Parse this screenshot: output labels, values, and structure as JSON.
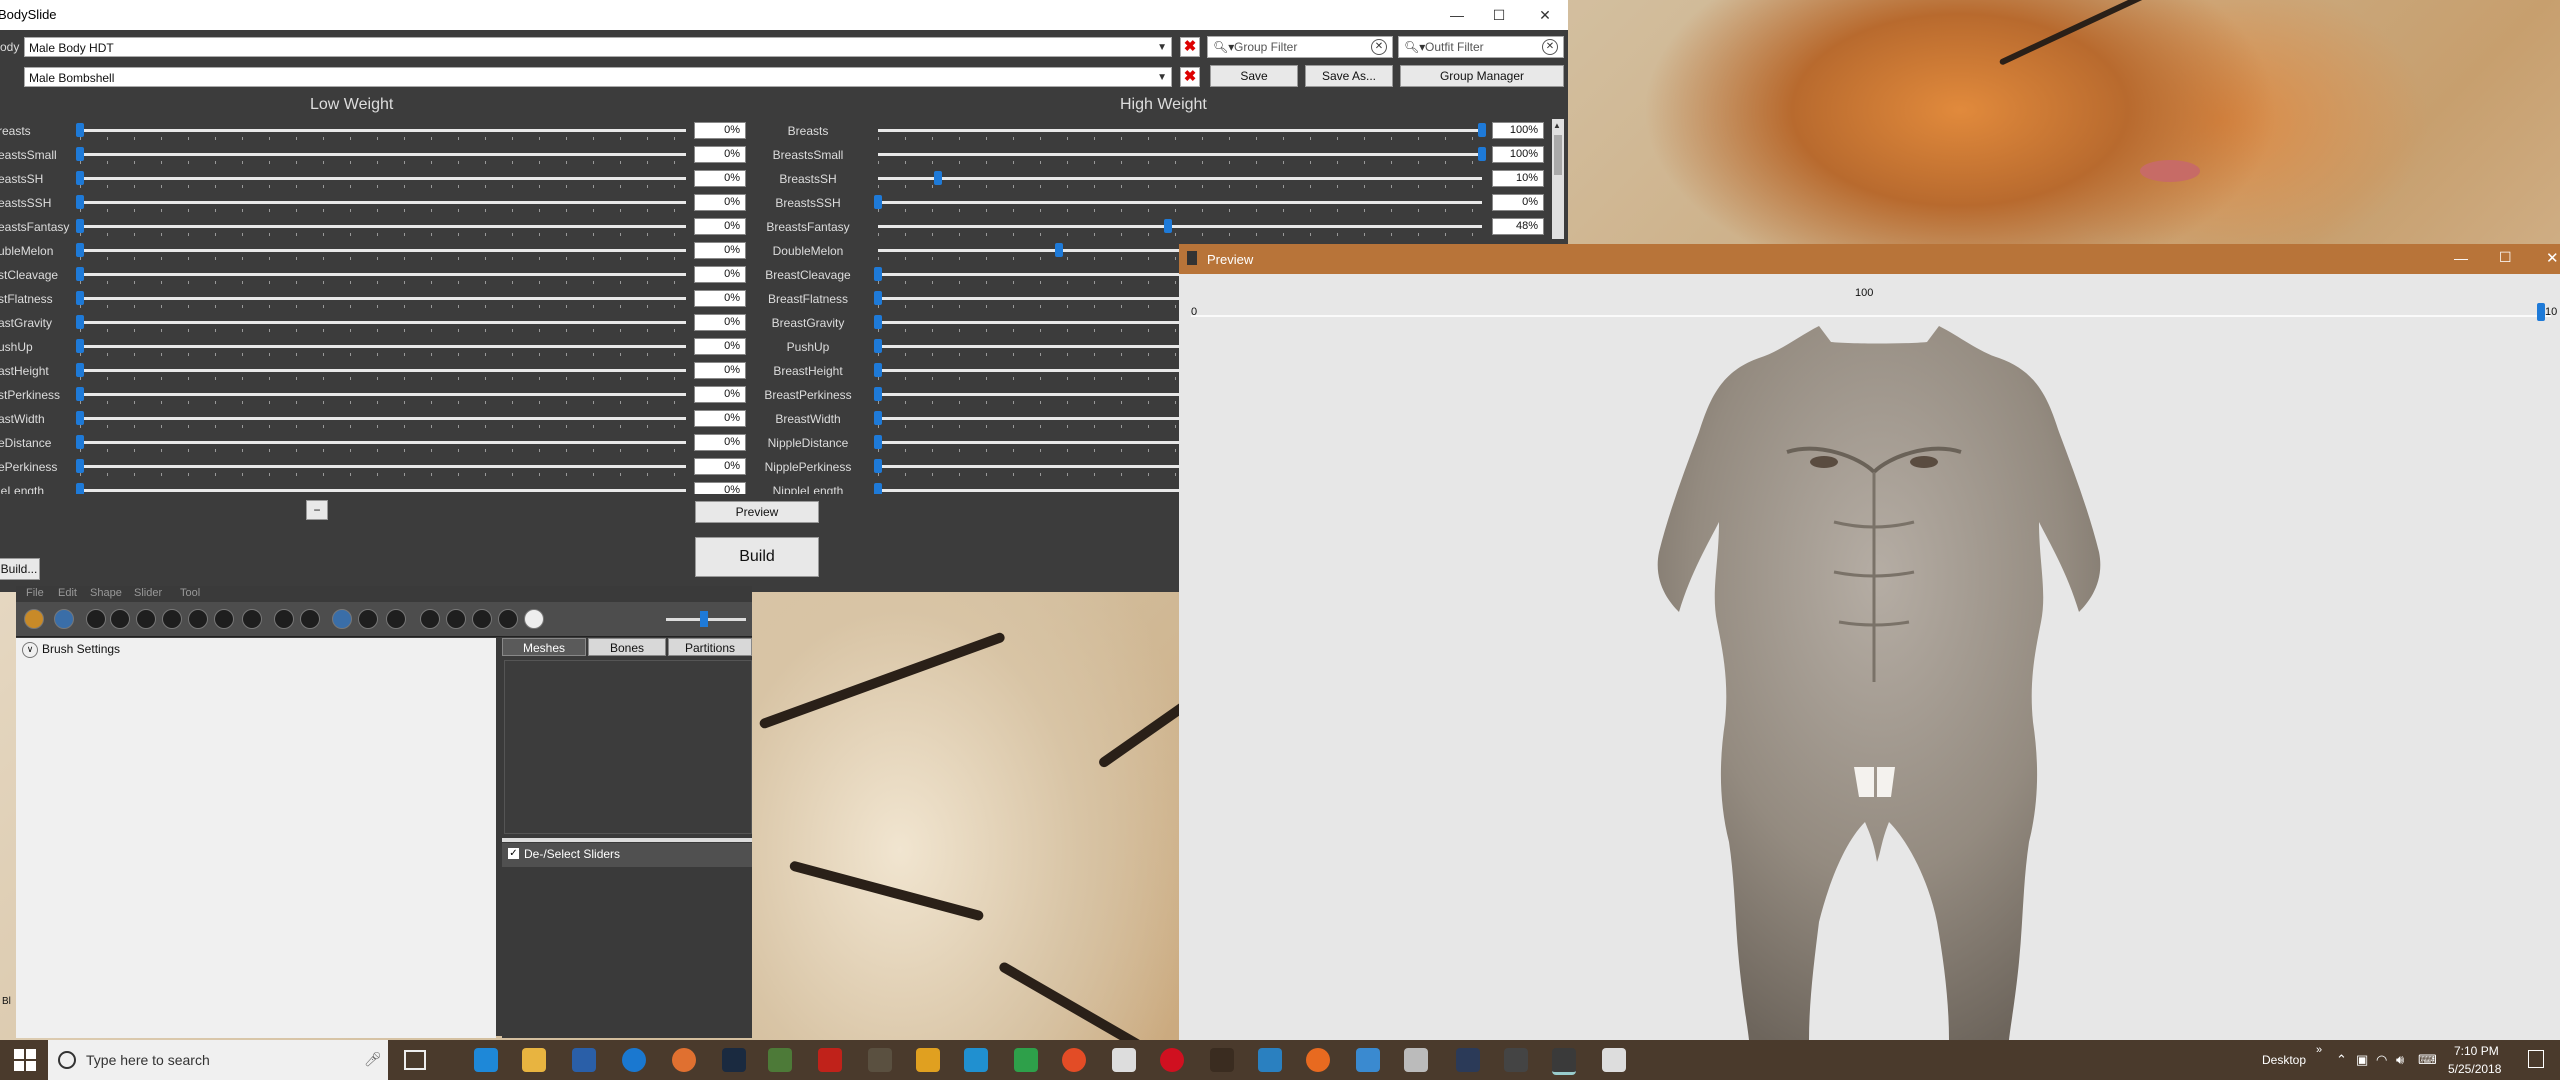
{
  "bodyslide": {
    "title": "BodySlide",
    "body_label": "Body",
    "outfit_value": "Male Body HDT",
    "preset_value": "Male Bombshell",
    "group_filter_placeholder": "Group Filter",
    "outfit_filter_placeholder": "Outfit Filter",
    "save_label": "Save",
    "save_as_label": "Save As...",
    "group_manager_label": "Group Manager",
    "low_weight_header": "Low Weight",
    "high_weight_header": "High Weight",
    "sliders": [
      {
        "left_label": "reasts",
        "name": "Breasts",
        "low": "0%",
        "high": "100%",
        "low_frac": 0.0,
        "high_frac": 1.0
      },
      {
        "left_label": "eastsSmall",
        "name": "BreastsSmall",
        "low": "0%",
        "high": "100%",
        "low_frac": 0.0,
        "high_frac": 1.0
      },
      {
        "left_label": "eastsSH",
        "name": "BreastsSH",
        "low": "0%",
        "high": "10%",
        "low_frac": 0.0,
        "high_frac": 0.1
      },
      {
        "left_label": "eastsSSH",
        "name": "BreastsSSH",
        "low": "0%",
        "high": "0%",
        "low_frac": 0.0,
        "high_frac": 0.0
      },
      {
        "left_label": "eastsFantasy",
        "name": "BreastsFantasy",
        "low": "0%",
        "high": "48%",
        "low_frac": 0.0,
        "high_frac": 0.48
      },
      {
        "left_label": "ubleMelon",
        "name": "DoubleMelon",
        "low": "0%",
        "high": "",
        "low_frac": 0.0,
        "high_frac": 0.3
      },
      {
        "left_label": "stCleavage",
        "name": "BreastCleavage",
        "low": "0%",
        "high": "",
        "low_frac": 0.0,
        "high_frac": 0.0
      },
      {
        "left_label": "stFlatness",
        "name": "BreastFlatness",
        "low": "0%",
        "high": "",
        "low_frac": 0.0,
        "high_frac": 0.0
      },
      {
        "left_label": "astGravity",
        "name": "BreastGravity",
        "low": "0%",
        "high": "",
        "low_frac": 0.0,
        "high_frac": 0.0
      },
      {
        "left_label": "ushUp",
        "name": "PushUp",
        "low": "0%",
        "high": "",
        "low_frac": 0.0,
        "high_frac": 0.0
      },
      {
        "left_label": "astHeight",
        "name": "BreastHeight",
        "low": "0%",
        "high": "",
        "low_frac": 0.0,
        "high_frac": 0.0
      },
      {
        "left_label": "stPerkiness",
        "name": "BreastPerkiness",
        "low": "0%",
        "high": "",
        "low_frac": 0.0,
        "high_frac": 0.0
      },
      {
        "left_label": "astWidth",
        "name": "BreastWidth",
        "low": "0%",
        "high": "",
        "low_frac": 0.0,
        "high_frac": 0.0
      },
      {
        "left_label": "eDistance",
        "name": "NippleDistance",
        "low": "0%",
        "high": "",
        "low_frac": 0.0,
        "high_frac": 0.0
      },
      {
        "left_label": "ePerkiness",
        "name": "NipplePerkiness",
        "low": "0%",
        "high": "",
        "low_frac": 0.0,
        "high_frac": 0.0
      },
      {
        "left_label": "leLength",
        "name": "NippleLength",
        "low": "0%",
        "high": "",
        "low_frac": 0.0,
        "high_frac": 0.0
      }
    ],
    "minus_label": "−",
    "preview_label": "Preview",
    "build_label": "Build",
    "batch_build_label": "Build..."
  },
  "outfit_studio": {
    "menu": [
      "File",
      "Edit",
      "Shape",
      "Slider",
      "Tool"
    ],
    "brush_settings_label": "Brush Settings",
    "tabs": [
      "Meshes",
      "Bones",
      "Partitions"
    ],
    "deselect_label": "De-/Select Sliders",
    "edge_label": "Bl"
  },
  "preview": {
    "title": "Preview",
    "weight_min": "0",
    "weight_value": "100",
    "weight_max": "10",
    "weight_frac": 1.0
  },
  "taskbar": {
    "search_placeholder": "Type here to search",
    "desktop_label": "Desktop",
    "time": "7:10 PM",
    "date": "5/25/2018"
  },
  "colors": {
    "slider_thumb": "#1e7ad8",
    "preview_title": "#b87439",
    "close_x": "#dd0000"
  }
}
